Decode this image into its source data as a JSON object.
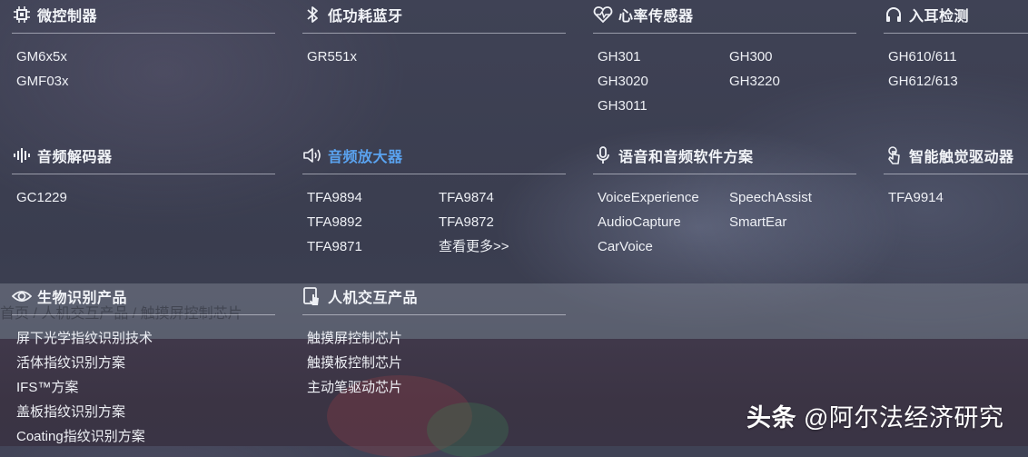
{
  "categories": [
    {
      "title": "微控制器",
      "icon": "chip-icon",
      "items": [
        "GM6x5x",
        "GMF03x"
      ]
    },
    {
      "title": "低功耗蓝牙",
      "icon": "bluetooth-icon",
      "items": [
        "GR551x"
      ]
    },
    {
      "title": "心率传感器",
      "icon": "heart-rate-icon",
      "items": [
        "GH301",
        "GH300",
        "GH3020",
        "GH3220",
        "GH3011"
      ]
    },
    {
      "title": "入耳检测",
      "icon": "headphones-icon",
      "items": [
        "GH610/611",
        "GH612/613"
      ]
    },
    {
      "title": "音频解码器",
      "icon": "audio-wave-icon",
      "items": [
        "GC1229"
      ]
    },
    {
      "title": "音频放大器",
      "icon": "speaker-icon",
      "items": [
        "TFA9894",
        "TFA9874",
        "TFA9892",
        "TFA9872",
        "TFA9871",
        "查看更多>>"
      ]
    },
    {
      "title": "语音和音频软件方案",
      "icon": "microphone-icon",
      "items": [
        "VoiceExperience",
        "SpeechAssist",
        "AudioCapture",
        "SmartEar",
        "CarVoice"
      ]
    },
    {
      "title": "智能触觉驱动器",
      "icon": "touch-icon",
      "items": [
        "TFA9914"
      ]
    },
    {
      "title": "生物识别产品",
      "icon": "eye-icon",
      "items": [
        "屏下光学指纹识别技术",
        "活体指纹识别方案",
        "IFS™方案",
        "盖板指纹识别方案",
        "Coating指纹识别方案"
      ]
    },
    {
      "title": "人机交互产品",
      "icon": "tablet-touch-icon",
      "items": [
        "触摸屏控制芯片",
        "触摸板控制芯片",
        "主动笔驱动芯片"
      ]
    }
  ],
  "background_breadcrumb": "首页  /  人机交互产品  /  触摸屏控制芯片",
  "watermark": {
    "platform": "头条",
    "handle": "@阿尔法经济研究"
  },
  "colors": {
    "active": "#5aa3f0",
    "text": "#eef0f5",
    "divider": "#e6e8f0"
  }
}
